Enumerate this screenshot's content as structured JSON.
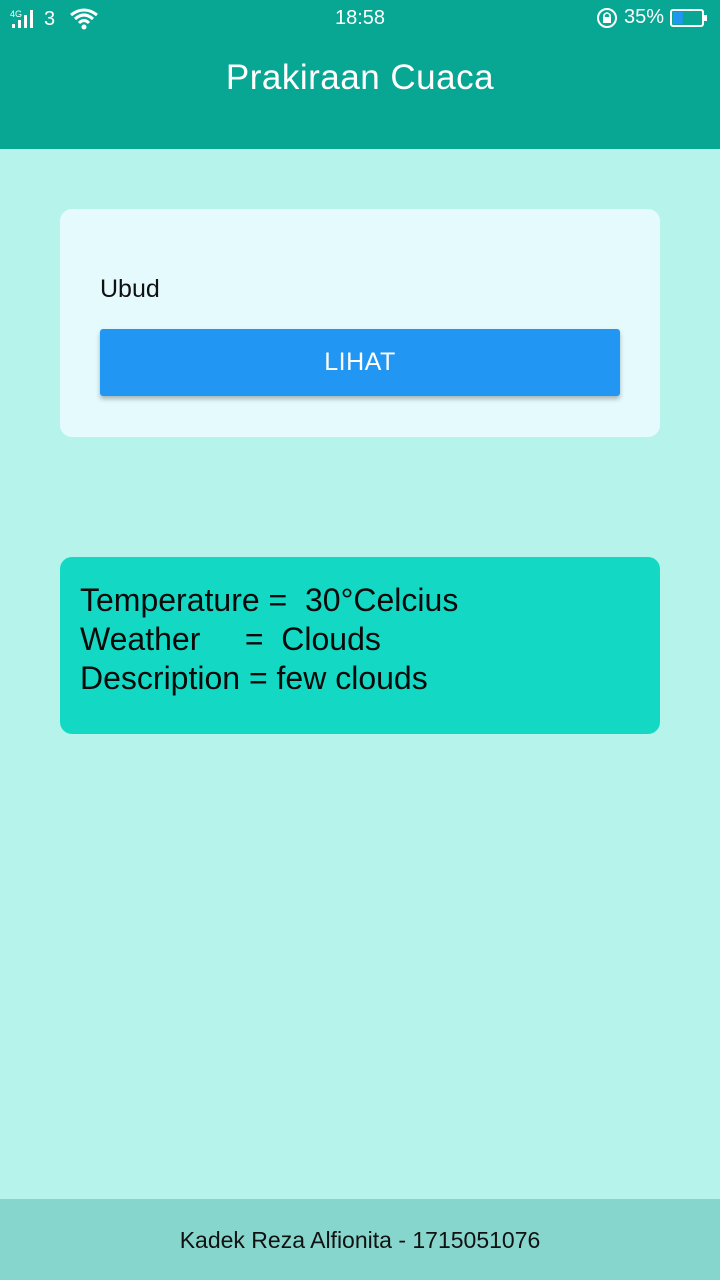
{
  "status_bar": {
    "network_type": "4G",
    "sim_number": "3",
    "time": "18:58",
    "battery_percent": "35%",
    "battery_level": 0.35
  },
  "app_bar": {
    "title": "Prakiraan Cuaca"
  },
  "input_card": {
    "city_value": "Ubud",
    "button_label": "LIHAT"
  },
  "result": {
    "temperature_line": "Temperature =  30°Celcius",
    "weather_line": "Weather     =  Clouds",
    "description_line": "Description = few clouds"
  },
  "footer": {
    "text": "Kadek Reza Alfionita - 1715051076"
  },
  "colors": {
    "primary": "#07a794",
    "background": "#b6f3eb",
    "button": "#2196f3",
    "result_card": "#13d9c4",
    "footer": "#86d6cd"
  }
}
